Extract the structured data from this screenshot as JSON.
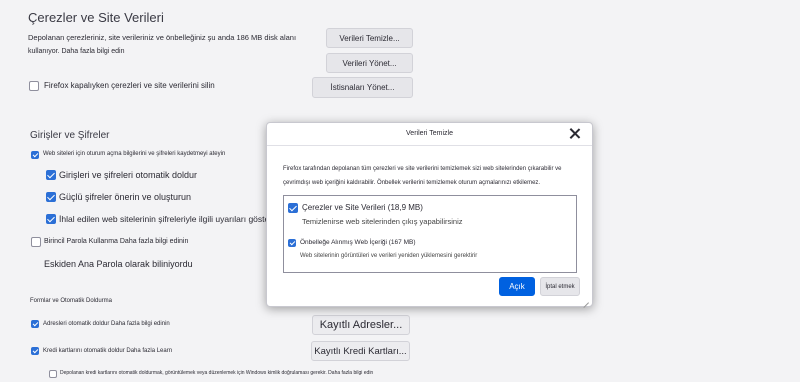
{
  "cookies": {
    "heading": "Çerezler ve Site Verileri",
    "desc_line1": "Depolanan çerezleriniz, site verileriniz ve önbelleğiniz şu anda 186 MB disk alanı",
    "desc_line2": "kullanıyor. Daha fazla bilgi edin",
    "clear_button": "Verileri Temizle...",
    "manage_button": "Verileri Yönet...",
    "delete_on_close": "Firefox kapalıyken çerezleri ve site verilerini silin",
    "exceptions_button": "İstisnaları Yönet..."
  },
  "logins": {
    "heading": "Girişler ve Şifreler",
    "ask_save": "Web siteleri için oturum açma bilgilerini ve şifreleri kaydetmeyi ateyin",
    "autofill": "Girişleri ve şifreleri otomatik doldur",
    "suggest": "Güçlü şifreler önerin ve oluşturun",
    "breach_alerts": "İhlal edilen web sitelerinin şifreleriyle ilgili uyarıları göster",
    "primary_password": "Birincil Parola Kullanma Daha fazla bilgi edinin",
    "former_name": "Eskiden Ana Parola olarak biliniyordu"
  },
  "forms": {
    "heading": "Formlar ve Otomatik Doldurma",
    "addresses": "Adresleri otomatik doldur Daha fazla bilgi edinin",
    "addresses_button": "Kayıtlı Adresler...",
    "cards": "Kredi kartlarını otomatik doldur Daha fazla Learn",
    "cards_button": "Kayıtlı Kredi Kartları...",
    "windows_auth": "Depolanan kredi kartlarını otomatik doldurmak, görüntülemek veya düzenlemek için Windows kimlik doğrulaması gerekir. Daha fazla bilgi edin"
  },
  "dialog": {
    "title": "Verileri Temizle",
    "info_line1": "Firefox tarafından depolanan tüm çerezleri ve site verilerini temizlemek sizi web sitelerinden çıkarabilir ve",
    "info_line2": "çevrimdışı web içeriğini kaldırabilir. Önbellek verilerini temizlemek oturum açmalarınızı etkilemez.",
    "option1_label": "Çerezler ve Site Verileri (18,9 MB)",
    "option1_sub": "Temizlenirse web sitelerinden çıkış yapabilirsiniz",
    "option2_label": "Önbelleğe Alınmış Web İçeriği (167 MB)",
    "option2_sub": "Web sitelerinin görüntüleri ve verileri yeniden yüklemesini gerektirir",
    "confirm_button": "Açık",
    "cancel_button": "İptal etmek"
  },
  "colors": {
    "accent": "#0061e0",
    "checkbox": "#2b6fd6"
  }
}
